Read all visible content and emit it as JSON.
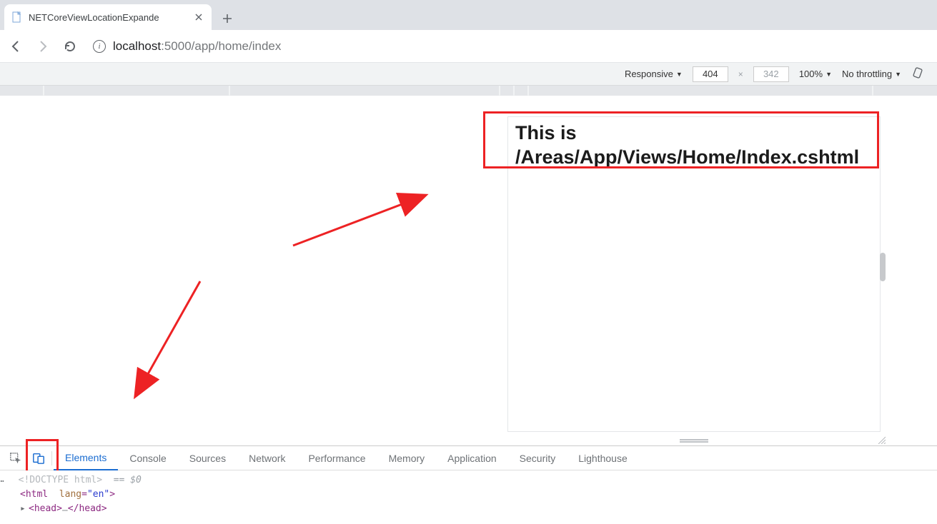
{
  "tab": {
    "title": "NETCoreViewLocationExpande"
  },
  "address": {
    "host": "localhost",
    "port": ":5000",
    "path": "/app/home/index"
  },
  "device_toolbar": {
    "mode": "Responsive",
    "width": "404",
    "height": "342",
    "zoom": "100%",
    "throttling": "No throttling"
  },
  "page": {
    "heading_line1": "This is",
    "heading_line2": "/Areas/App/Views/Home/Index.cshtml"
  },
  "devtools": {
    "tabs": [
      "Elements",
      "Console",
      "Sources",
      "Network",
      "Performance",
      "Memory",
      "Application",
      "Security",
      "Lighthouse"
    ],
    "active_tab": "Elements",
    "dom": {
      "doctype": "<!DOCTYPE html>",
      "selected_suffix": "== $0",
      "html_open_tag": "html",
      "html_attr_name": "lang",
      "html_attr_val": "en",
      "head_tag": "head"
    }
  }
}
